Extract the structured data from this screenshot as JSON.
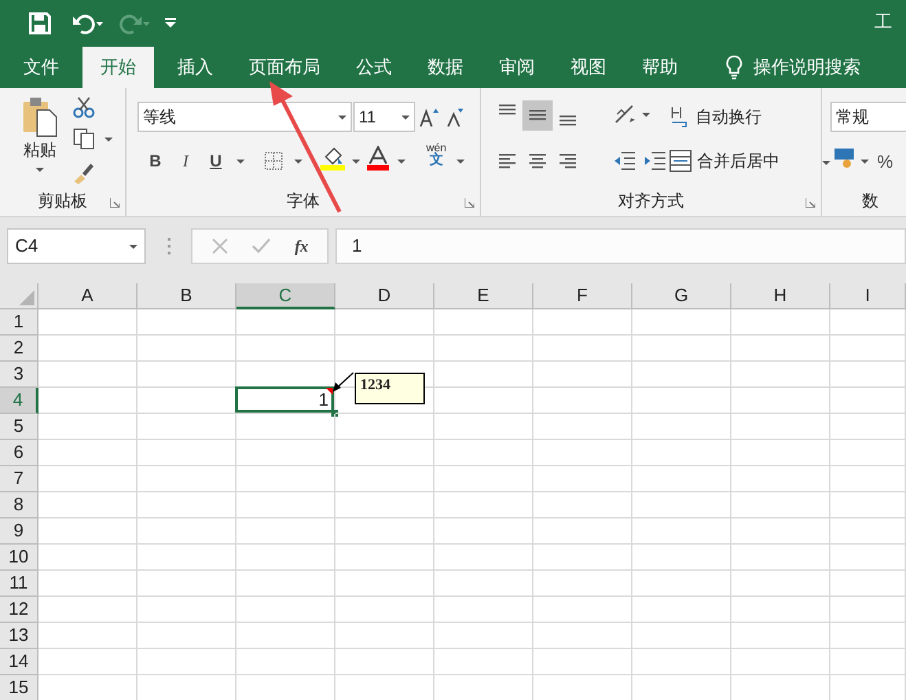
{
  "window": {
    "title": "工"
  },
  "tabs": [
    {
      "label": "文件",
      "selected": false
    },
    {
      "label": "开始",
      "selected": true
    },
    {
      "label": "插入",
      "selected": false
    },
    {
      "label": "页面布局",
      "selected": false
    },
    {
      "label": "公式",
      "selected": false
    },
    {
      "label": "数据",
      "selected": false
    },
    {
      "label": "审阅",
      "selected": false
    },
    {
      "label": "视图",
      "selected": false
    },
    {
      "label": "帮助",
      "selected": false
    }
  ],
  "search": {
    "label": "操作说明搜索"
  },
  "clipboard": {
    "paste": "粘贴",
    "group_label": "剪贴板"
  },
  "font": {
    "name": "等线",
    "size": "11",
    "wen": "wén",
    "wen_char": "文",
    "group_label": "字体",
    "bold": "B",
    "italic": "I",
    "underline": "U"
  },
  "alignment": {
    "vertical": [
      {
        "selected": false
      },
      {
        "selected": true
      },
      {
        "selected": false
      }
    ],
    "wrap": "自动换行",
    "merge": "合并后居中",
    "group_label": "对齐方式"
  },
  "number": {
    "format": "常规",
    "percent": "%",
    "group_label": "数"
  },
  "formula_bar": {
    "name_box": "C4",
    "function_label": "fx",
    "value": "1"
  },
  "grid": {
    "columns": [
      {
        "label": "A",
        "selected": false
      },
      {
        "label": "B",
        "selected": false
      },
      {
        "label": "C",
        "selected": true
      },
      {
        "label": "D",
        "selected": false
      },
      {
        "label": "E",
        "selected": false
      },
      {
        "label": "F",
        "selected": false
      },
      {
        "label": "G",
        "selected": false
      },
      {
        "label": "H",
        "selected": false
      },
      {
        "label": "I",
        "selected": false
      }
    ],
    "rows": [
      {
        "label": "1",
        "selected": false
      },
      {
        "label": "2",
        "selected": false
      },
      {
        "label": "3",
        "selected": false
      },
      {
        "label": "4",
        "selected": true
      },
      {
        "label": "5",
        "selected": false
      },
      {
        "label": "6",
        "selected": false
      },
      {
        "label": "7",
        "selected": false
      },
      {
        "label": "8",
        "selected": false
      },
      {
        "label": "9",
        "selected": false
      },
      {
        "label": "10",
        "selected": false
      },
      {
        "label": "11",
        "selected": false
      },
      {
        "label": "12",
        "selected": false
      },
      {
        "label": "13",
        "selected": false
      },
      {
        "label": "14",
        "selected": false
      },
      {
        "label": "15",
        "selected": false
      }
    ],
    "active_cell": {
      "value": "1",
      "comment": "1234"
    }
  }
}
